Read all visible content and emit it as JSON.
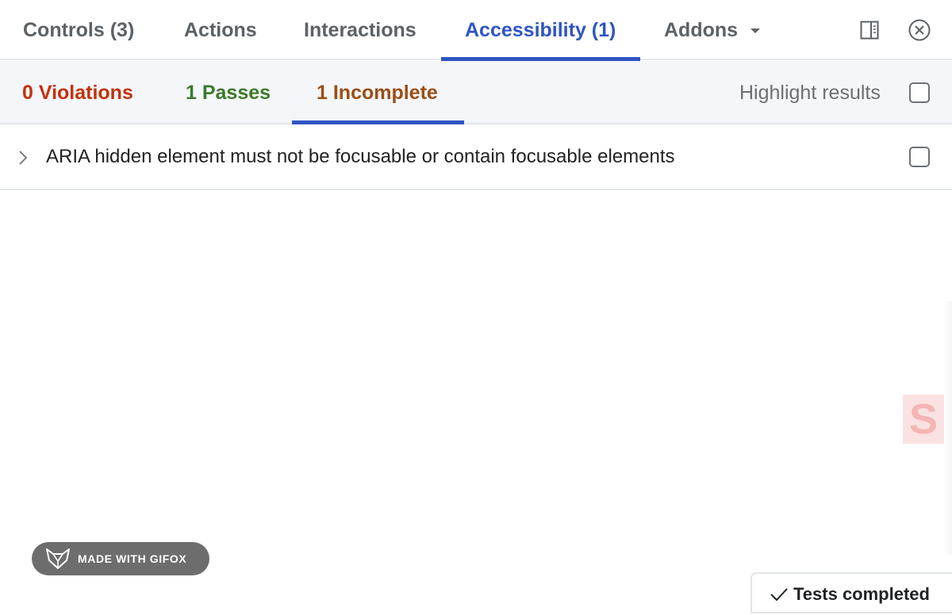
{
  "tabs": [
    {
      "label": "Controls (3)"
    },
    {
      "label": "Actions"
    },
    {
      "label": "Interactions"
    },
    {
      "label": "Accessibility (1)"
    },
    {
      "label": "Addons"
    }
  ],
  "icons": {
    "panel": "panel-toggle-icon",
    "close": "close-icon",
    "expand": "chevron-right-icon",
    "gifox": "fox-logo-icon",
    "status": "checkmark-icon"
  },
  "subtabs": [
    {
      "label": "0 Violations",
      "color": "#c2320b"
    },
    {
      "label": "1 Passes",
      "color": "#3b7a2b"
    },
    {
      "label": "1 Incomplete",
      "color": "#9b4e13"
    }
  ],
  "highlight": {
    "label": "Highlight results",
    "checked": false
  },
  "results": [
    {
      "title": "ARIA hidden element must not be focusable or contain focusable elements",
      "checked": false
    }
  ],
  "badge": {
    "text": "MADE WITH GIFOX"
  },
  "status": {
    "text": "Tests completed"
  },
  "colors": {
    "accent": "#2f55c4"
  }
}
